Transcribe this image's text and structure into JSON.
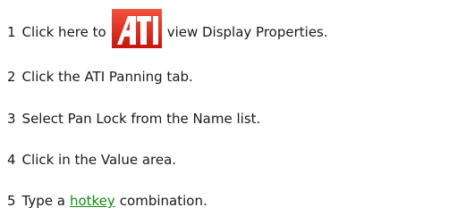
{
  "steps": [
    {
      "number": "1",
      "before": "Click here to",
      "after": "view Display Properties."
    },
    {
      "number": "2",
      "text": "Click the ATI Panning tab."
    },
    {
      "number": "3",
      "text": "Select Pan Lock from the Name list."
    },
    {
      "number": "4",
      "text": "Click in the Value area."
    },
    {
      "number": "5",
      "before": "Type a",
      "link": "hotkey",
      "after": "combination."
    }
  ],
  "logo_icon": "ati-logo-icon",
  "colors": {
    "logo_red": "#e8281e",
    "link_green": "#138a13"
  }
}
